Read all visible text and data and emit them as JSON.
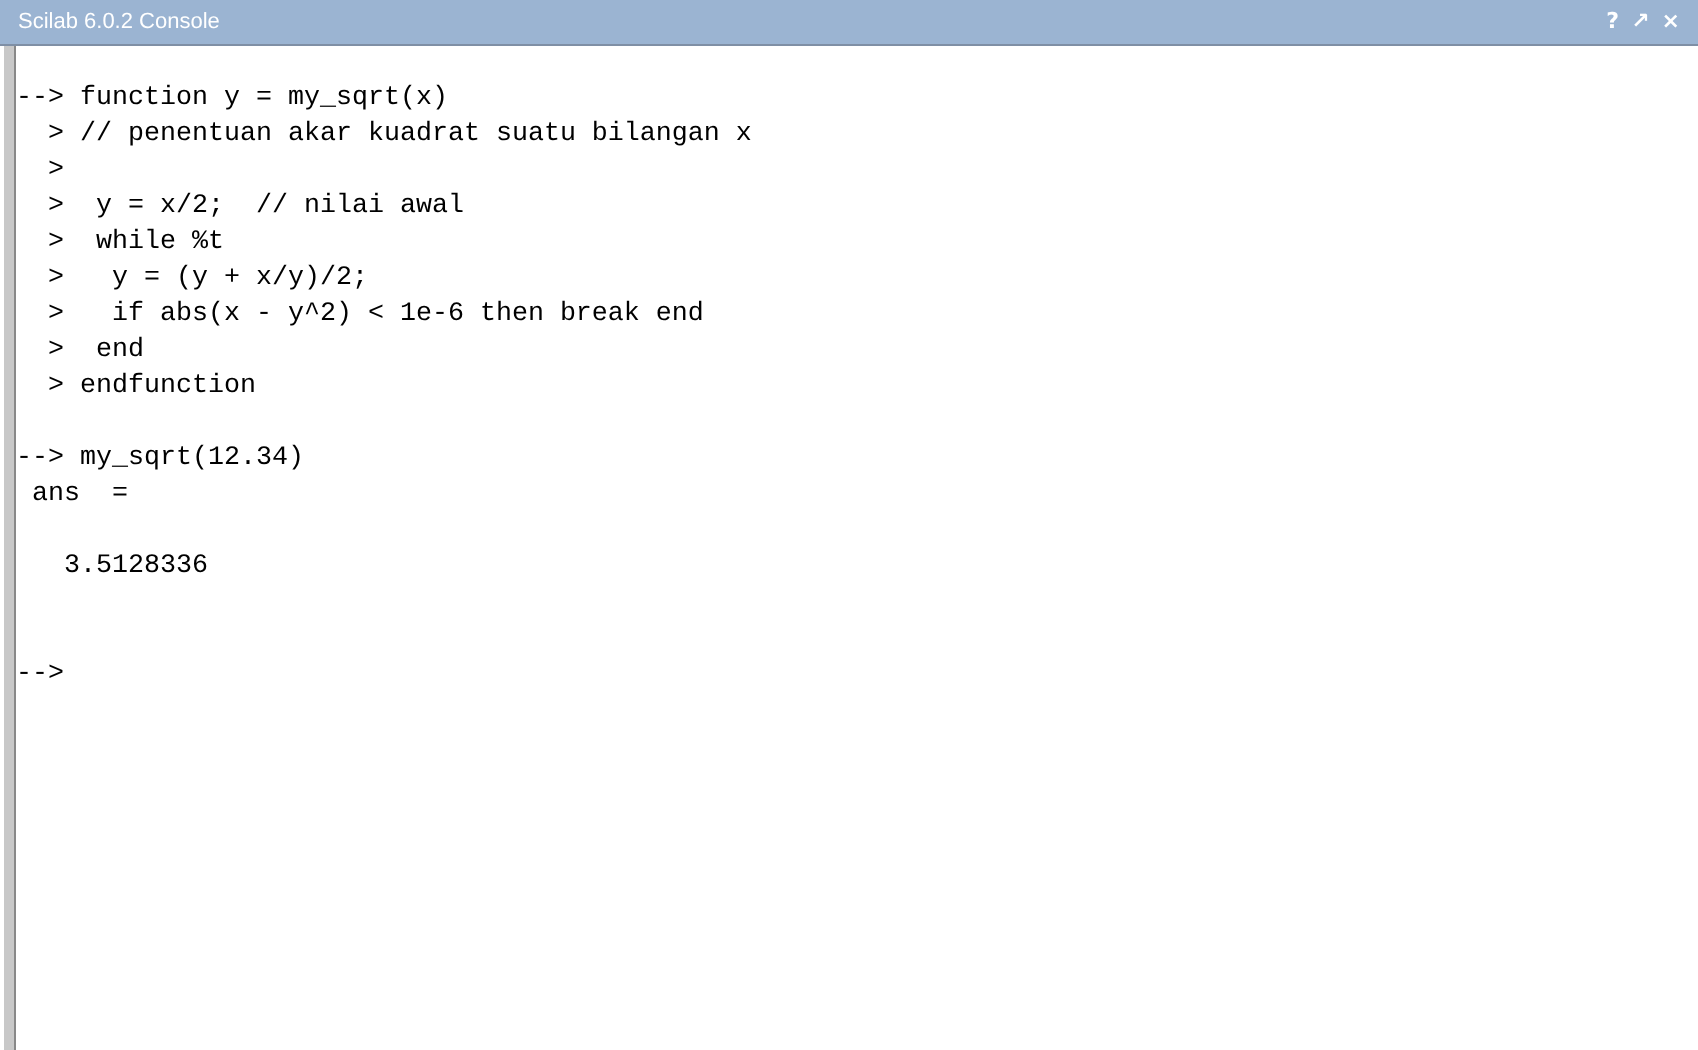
{
  "window": {
    "title": "Scilab 6.0.2 Console",
    "buttons": [
      "?",
      "↗",
      "×"
    ]
  },
  "console": {
    "lines": [
      {
        "kind": "text",
        "text": "--> function y = my_sqrt(x)"
      },
      {
        "kind": "text",
        "text": "  > // penentuan akar kuadrat suatu bilangan x"
      },
      {
        "kind": "text",
        "text": "  >"
      },
      {
        "kind": "text",
        "text": "  >  y = x/2;  // nilai awal"
      },
      {
        "kind": "text",
        "text": "  >  while %t"
      },
      {
        "kind": "text",
        "text": "  >   y = (y + x/y)/2;"
      },
      {
        "kind": "text",
        "text": "  >   if abs(x - y^2) < 1e-6 then break end"
      },
      {
        "kind": "text",
        "text": "  >  end"
      },
      {
        "kind": "text",
        "text": "  > endfunction"
      },
      {
        "kind": "blank"
      },
      {
        "kind": "text",
        "text": "--> my_sqrt(12.34)"
      },
      {
        "kind": "text",
        "text": " ans  ="
      },
      {
        "kind": "blank"
      },
      {
        "kind": "text",
        "text": "   3.5128336"
      },
      {
        "kind": "blank"
      },
      {
        "kind": "blank"
      },
      {
        "kind": "text",
        "text": "-->"
      }
    ]
  }
}
